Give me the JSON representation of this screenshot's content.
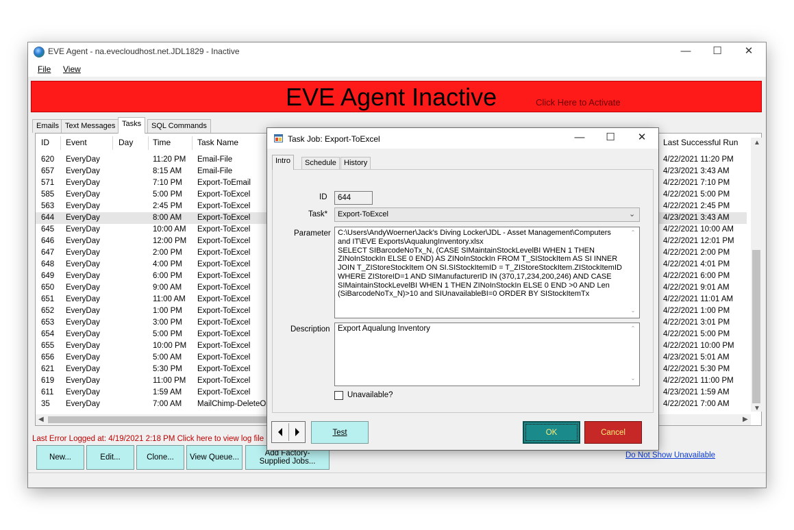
{
  "window": {
    "title": "EVE Agent - na.evecloudhost.net.JDL1829 - Inactive",
    "controls": {
      "minimize": "—",
      "maximize": "☐",
      "close": "✕"
    }
  },
  "menu": [
    "File",
    "View"
  ],
  "banner": {
    "title": "EVE Agent Inactive",
    "activate": "Click Here to Activate",
    "color": "#ff1a1a"
  },
  "tabs": [
    "Emails",
    "Text Messages",
    "Tasks",
    "SQL Commands"
  ],
  "active_tab": "Tasks",
  "columns": [
    "ID",
    "Event",
    "Day",
    "Time",
    "Task Name",
    "Last Successful Run"
  ],
  "rows": [
    [
      "620",
      "EveryDay",
      "",
      "11:20 PM",
      "Email-File",
      "4/22/2021 11:20 PM"
    ],
    [
      "657",
      "EveryDay",
      "",
      "8:15 AM",
      "Email-File",
      "4/23/2021 3:43 AM"
    ],
    [
      "571",
      "EveryDay",
      "",
      "7:10 PM",
      "Export-ToEmail",
      "4/22/2021 7:10 PM"
    ],
    [
      "585",
      "EveryDay",
      "",
      "5:00 PM",
      "Export-ToExcel",
      "4/22/2021 5:00 PM"
    ],
    [
      "563",
      "EveryDay",
      "",
      "2:45 PM",
      "Export-ToExcel",
      "4/22/2021 2:45 PM"
    ],
    [
      "644",
      "EveryDay",
      "",
      "8:00 AM",
      "Export-ToExcel",
      "4/23/2021 3:43 AM"
    ],
    [
      "645",
      "EveryDay",
      "",
      "10:00 AM",
      "Export-ToExcel",
      "4/22/2021 10:00 AM"
    ],
    [
      "646",
      "EveryDay",
      "",
      "12:00 PM",
      "Export-ToExcel",
      "4/22/2021 12:01 PM"
    ],
    [
      "647",
      "EveryDay",
      "",
      "2:00 PM",
      "Export-ToExcel",
      "4/22/2021 2:00 PM"
    ],
    [
      "648",
      "EveryDay",
      "",
      "4:00 PM",
      "Export-ToExcel",
      "4/22/2021 4:01 PM"
    ],
    [
      "649",
      "EveryDay",
      "",
      "6:00 PM",
      "Export-ToExcel",
      "4/22/2021 6:00 PM"
    ],
    [
      "650",
      "EveryDay",
      "",
      "9:00 AM",
      "Export-ToExcel",
      "4/22/2021 9:01 AM"
    ],
    [
      "651",
      "EveryDay",
      "",
      "11:00 AM",
      "Export-ToExcel",
      "4/22/2021 11:01 AM"
    ],
    [
      "652",
      "EveryDay",
      "",
      "1:00 PM",
      "Export-ToExcel",
      "4/22/2021 1:00 PM"
    ],
    [
      "653",
      "EveryDay",
      "",
      "3:00 PM",
      "Export-ToExcel",
      "4/22/2021 3:01 PM"
    ],
    [
      "654",
      "EveryDay",
      "",
      "5:00 PM",
      "Export-ToExcel",
      "4/22/2021 5:00 PM"
    ],
    [
      "655",
      "EveryDay",
      "",
      "10:00 PM",
      "Export-ToExcel",
      "4/22/2021 10:00 PM"
    ],
    [
      "656",
      "EveryDay",
      "",
      "5:00 AM",
      "Export-ToExcel",
      "4/23/2021 5:01 AM"
    ],
    [
      "621",
      "EveryDay",
      "",
      "5:30 PM",
      "Export-ToExcel",
      "4/22/2021 5:30 PM"
    ],
    [
      "619",
      "EveryDay",
      "",
      "11:00 PM",
      "Export-ToExcel",
      "4/22/2021 11:00 PM"
    ],
    [
      "611",
      "EveryDay",
      "",
      "1:59 AM",
      "Export-ToExcel",
      "4/23/2021 1:59 AM"
    ],
    [
      "35",
      "EveryDay",
      "",
      "7:00 AM",
      "MailChimp-DeleteOldC",
      "4/22/2021 7:00 AM"
    ]
  ],
  "selected_row_id": "644",
  "error_line": "Last Error Logged at: 4/19/2021 2:18 PM   Click here to view log file",
  "buttons": {
    "new": "New...",
    "edit": "Edit...",
    "clone": "Clone...",
    "view_queue": "View Queue...",
    "add_factory": "Add Factory-Supplied Jobs..."
  },
  "do_not_show_link": "Do Not Show Unavailable",
  "dialog": {
    "title": "Task Job: Export-ToExcel",
    "tabs": [
      "Intro",
      "Schedule",
      "History"
    ],
    "active_tab": "Intro",
    "labels": {
      "id": "ID",
      "task": "Task*",
      "parameter": "Parameter",
      "description": "Description",
      "unavailable": "Unavailable?"
    },
    "id_value": "644",
    "task_value": "Export-ToExcel",
    "parameter": "C:\\Users\\AndyWoerner\\Jack's Diving Locker\\JDL - Asset Management\\Computers and IT\\EVE Exports\\AqualungInventory.xlsx\nSELECT SIBarcodeNoTx_N, (CASE SIMaintainStockLevelBI WHEN 1 THEN ZINoInStockIn ELSE 0 END) AS ZINoInStockIn FROM T_SIStockItem AS SI INNER JOIN T_ZIStoreStockItem ON SI.SIStockItemID = T_ZIStoreStockItem.ZIStockItemID WHERE ZIStoreID=1 AND SIManufacturerID IN (370,17,234,200,246) AND CASE SIMaintainStockLevelBI WHEN 1 THEN ZINoInStockIn ELSE 0 END >0 AND Len (SiBarcodeNoTx_N)>10 and SIUnavailableBI=0 ORDER BY SIStockItemTx",
    "description": "Export Aqualung Inventory",
    "unavailable_checked": false,
    "test_label": "Test",
    "ok_label": "OK",
    "cancel_label": "Cancel",
    "ok_color": "#1a8a8a",
    "cancel_color": "#c62828"
  }
}
